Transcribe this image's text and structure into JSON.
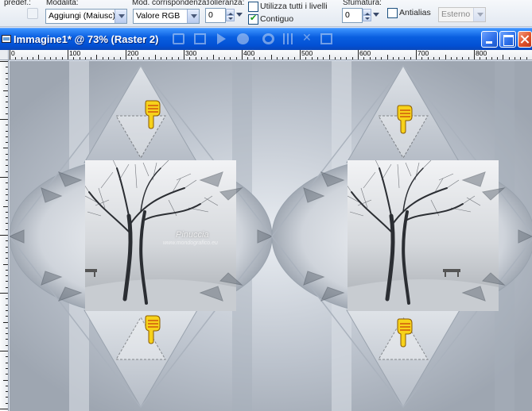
{
  "toolbar": {
    "preset_label": "predef.:",
    "mode_label": "Modalità:",
    "mode_value": "Aggiungi (Maiusc)",
    "match_label": "Mod. corrispondenza:",
    "match_value": "Valore RGB",
    "tolerance_label": "Tolleranza:",
    "tolerance_value": "0",
    "use_all_layers_label": "Utilizza tutti i livelli",
    "use_all_layers_checked": false,
    "contiguous_label": "Contiguo",
    "contiguous_checked": true,
    "feather_label": "Sfumatura:",
    "feather_value": "0",
    "antialias_label": "Antialias",
    "antialias_checked": false,
    "antialias_mode_value": "Esterno"
  },
  "window": {
    "title": "Immagine1* @  73% (Raster 2)"
  },
  "ruler": {
    "labels": [
      "0",
      "100",
      "200",
      "300",
      "400",
      "500",
      "600",
      "700",
      "800"
    ]
  },
  "canvas": {
    "watermark": "Pinuccia",
    "watermark_sub": "www.mondografico.eu"
  },
  "colors": {
    "titlebar": "#0a5fe0",
    "canvas_bg": "#c3c9d3",
    "selection_marquee": "#000000",
    "pointer_hand": "#f7d21a"
  },
  "icons": [
    "preset-icon",
    "window-app-icon",
    "minimize-icon",
    "maximize-icon",
    "close-icon",
    "pointing-hand-icon"
  ]
}
